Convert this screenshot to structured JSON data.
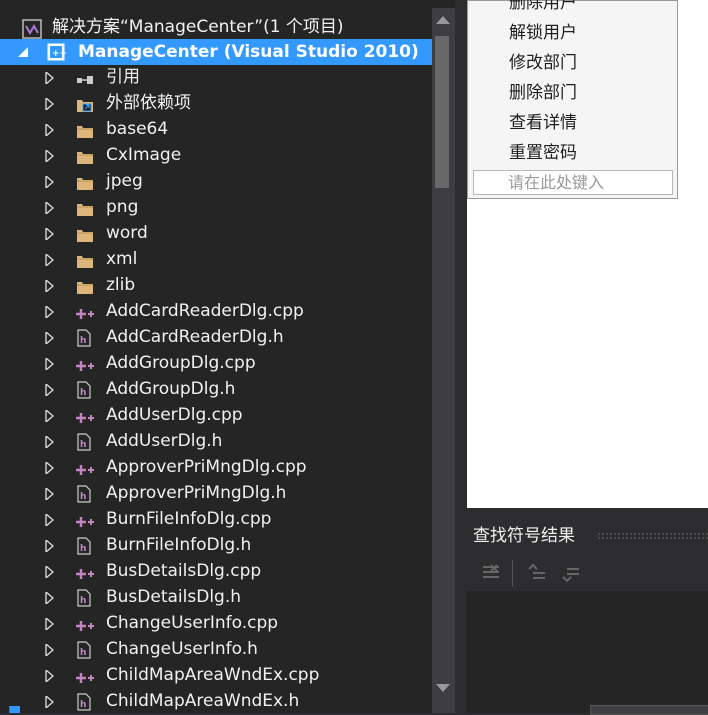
{
  "solution_explorer": {
    "solution_title": "解决方案“ManageCenter”(1 个项目)",
    "project_title": "ManageCenter (Visual Studio 2010)",
    "items": [
      {
        "label": "引用",
        "icon": "references-icon"
      },
      {
        "label": "外部依赖项",
        "icon": "external-deps-icon"
      },
      {
        "label": "base64",
        "icon": "folder-icon"
      },
      {
        "label": "CxImage",
        "icon": "folder-icon"
      },
      {
        "label": "jpeg",
        "icon": "folder-icon"
      },
      {
        "label": "png",
        "icon": "folder-icon"
      },
      {
        "label": "word",
        "icon": "folder-icon"
      },
      {
        "label": "xml",
        "icon": "folder-icon"
      },
      {
        "label": "zlib",
        "icon": "folder-icon"
      },
      {
        "label": "AddCardReaderDlg.cpp",
        "icon": "cpp-file-icon"
      },
      {
        "label": "AddCardReaderDlg.h",
        "icon": "header-file-icon"
      },
      {
        "label": "AddGroupDlg.cpp",
        "icon": "cpp-file-icon"
      },
      {
        "label": "AddGroupDlg.h",
        "icon": "header-file-icon"
      },
      {
        "label": "AddUserDlg.cpp",
        "icon": "cpp-file-icon"
      },
      {
        "label": "AddUserDlg.h",
        "icon": "header-file-icon"
      },
      {
        "label": "ApproverPriMngDlg.cpp",
        "icon": "cpp-file-icon"
      },
      {
        "label": "ApproverPriMngDlg.h",
        "icon": "header-file-icon"
      },
      {
        "label": "BurnFileInfoDlg.cpp",
        "icon": "cpp-file-icon"
      },
      {
        "label": "BurnFileInfoDlg.h",
        "icon": "header-file-icon"
      },
      {
        "label": "BusDetailsDlg.cpp",
        "icon": "cpp-file-icon"
      },
      {
        "label": "BusDetailsDlg.h",
        "icon": "header-file-icon"
      },
      {
        "label": "ChangeUserInfo.cpp",
        "icon": "cpp-file-icon"
      },
      {
        "label": "ChangeUserInfo.h",
        "icon": "header-file-icon"
      },
      {
        "label": "ChildMapAreaWndEx.cpp",
        "icon": "cpp-file-icon"
      },
      {
        "label": "ChildMapAreaWndEx.h",
        "icon": "header-file-icon"
      }
    ]
  },
  "menu_dropdown": {
    "items": [
      "删除用户",
      "解锁用户",
      "修改部门",
      "删除部门",
      "查看详情",
      "重置密码"
    ],
    "type_here_placeholder": "请在此处键入"
  },
  "find_symbol": {
    "title": "查找符号结果"
  },
  "colors": {
    "selection": "#3399ff",
    "panel_bg": "#252526",
    "text": "#f1f1f1",
    "cpp_icon": "#c586c0",
    "folder": "#dcb67a"
  }
}
